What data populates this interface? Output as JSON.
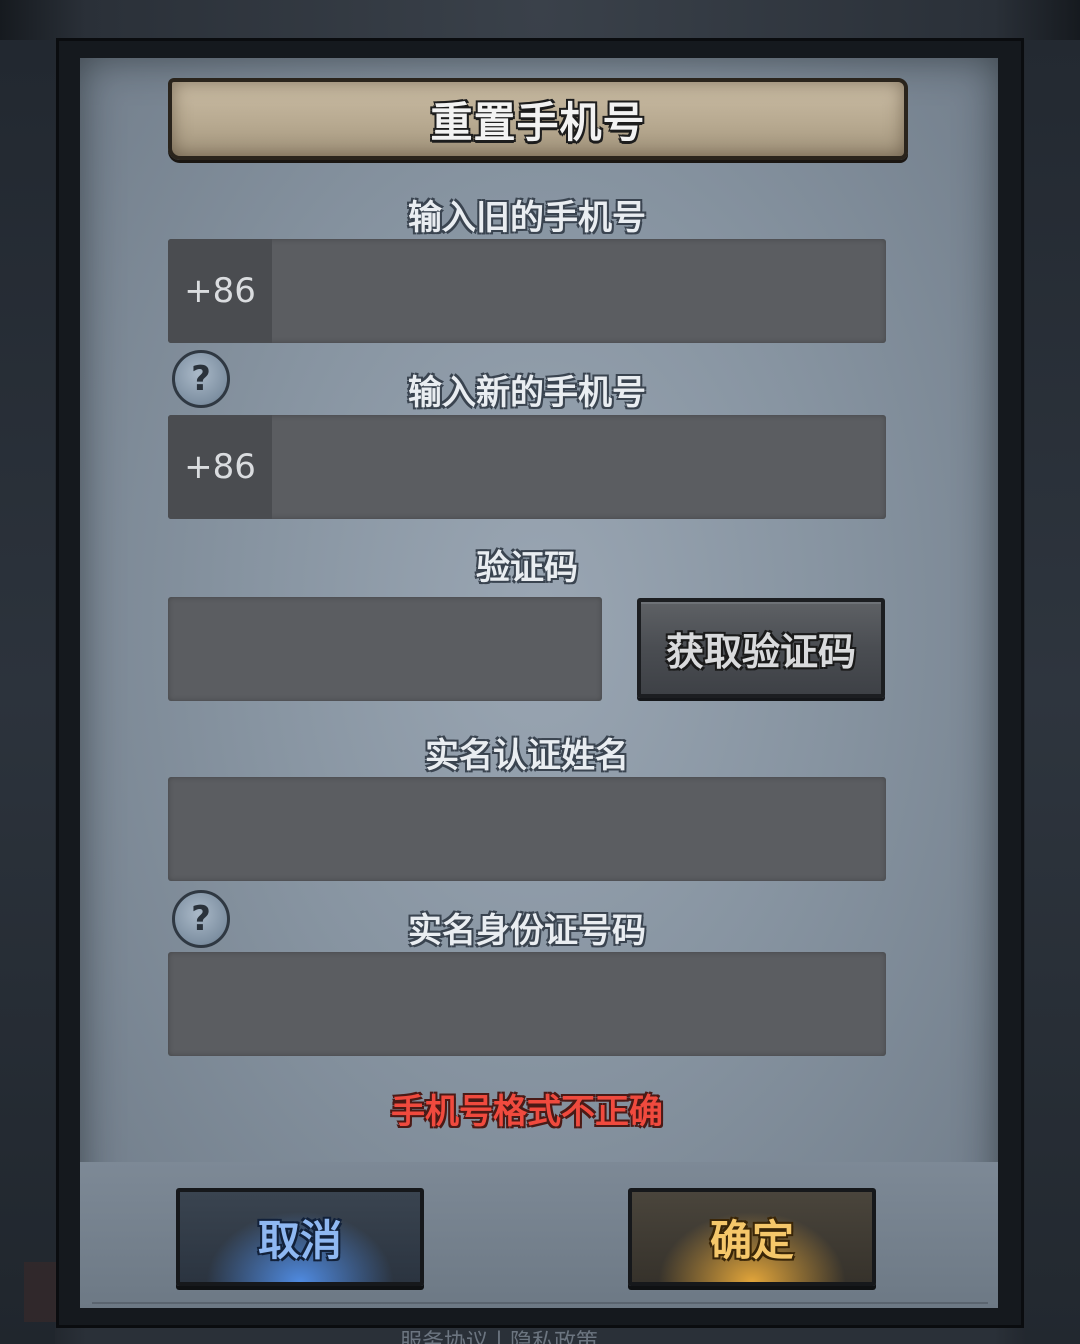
{
  "dialog": {
    "title": "重置手机号"
  },
  "old_phone": {
    "label": "输入旧的手机号",
    "country_code": "+86",
    "value": ""
  },
  "new_phone": {
    "label": "输入新的手机号",
    "country_code": "+86",
    "value": "",
    "help_icon": "question-mark"
  },
  "verification": {
    "label": "验证码",
    "value": "",
    "get_code_label": "获取验证码"
  },
  "real_name": {
    "label": "实名认证姓名",
    "value": ""
  },
  "id_number": {
    "label": "实名身份证号码",
    "value": "",
    "help_icon": "question-mark"
  },
  "error_message": "手机号格式不正确",
  "actions": {
    "cancel_label": "取消",
    "confirm_label": "确定"
  },
  "background_peek_text": "服务协议丨隐私政策",
  "colors": {
    "error": "#f04a3e",
    "cancel_glow": "#4f8ae0",
    "confirm_glow": "#e2a53a",
    "panel": "#8794a1"
  }
}
